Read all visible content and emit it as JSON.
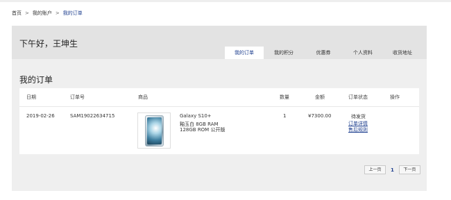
{
  "breadcrumb": {
    "home": "首页",
    "account": "我的账户",
    "current": "我的订单",
    "sep": ">"
  },
  "header": {
    "greeting": "下午好，王坤生",
    "tabs": [
      {
        "label": "我的订单"
      },
      {
        "label": "我的积分"
      },
      {
        "label": "优惠券"
      },
      {
        "label": "个人资料"
      },
      {
        "label": "收货地址"
      }
    ]
  },
  "orders": {
    "title": "我的订单",
    "columns": {
      "date": "日期",
      "order_no": "订单号",
      "product": "商品",
      "quantity": "数量",
      "amount": "金额",
      "status": "订单状态",
      "action": "操作"
    },
    "rows": [
      {
        "date": "2019-02-26",
        "order_no": "SAM19022634715",
        "product_name": "Galaxy S10+",
        "product_spec1": "釉玉白   8GB RAM",
        "product_spec2": "128GB ROM   公开版",
        "quantity": "1",
        "amount": "¥7300.00",
        "status": "待发货",
        "detail_link": "订单详情",
        "aftersale_link": "售后规则"
      }
    ]
  },
  "pagination": {
    "prev": "上一页",
    "current_page": "1",
    "next": "下一页"
  },
  "colors": {
    "accent": "#1e3f8f",
    "panel_bg": "#efefef",
    "header_bg": "#e3e3e3"
  }
}
